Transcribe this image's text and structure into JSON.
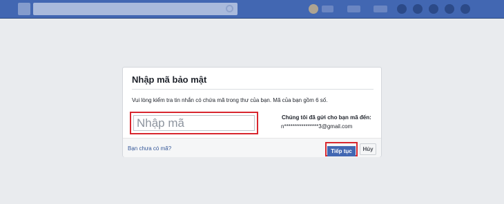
{
  "dialog": {
    "title": "Nhập mã bảo mật",
    "instructions": "Vui lòng kiểm tra tin nhắn có chứa mã trong thư của bạn. Mã của bạn gồm 6 số.",
    "code_input": {
      "placeholder": "Nhập mã",
      "value": ""
    },
    "sent_to_label": "Chúng tôi đã gửi cho bạn mã đến:",
    "sent_to_email": "n****************3@gmail.com",
    "no_code_link": "Bạn chưa có mã?",
    "continue_label": "Tiếp tục",
    "cancel_label": "Hủy"
  },
  "colors": {
    "header_blue": "#4267b2",
    "page_background": "#e9ebee",
    "link_blue": "#365899",
    "highlight_red": "#d8262e"
  }
}
